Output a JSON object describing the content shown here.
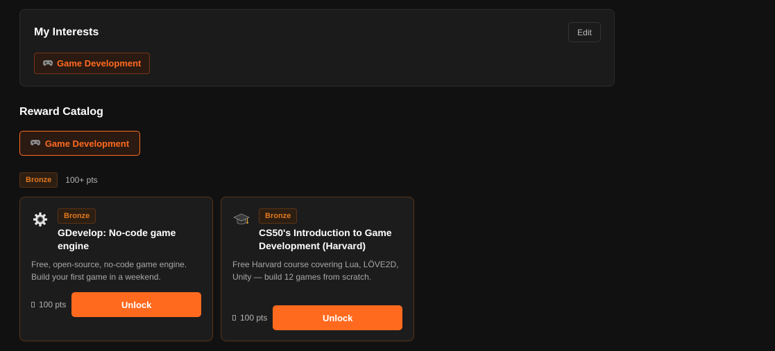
{
  "interests": {
    "title": "My Interests",
    "edit_label": "Edit",
    "items": [
      {
        "icon": "gamepad-icon",
        "label": "Game Development"
      }
    ]
  },
  "catalog": {
    "title": "Reward Catalog",
    "filter": {
      "icon": "gamepad-icon",
      "label": "Game Development"
    },
    "tier": {
      "label": "Bronze",
      "points": "100+ pts"
    },
    "rewards": [
      {
        "icon": "gear-icon",
        "badge": "Bronze",
        "title": "GDevelop: No-code game engine",
        "description": "Free, open-source, no-code game engine. Build your first game in a weekend.",
        "points": "100 pts",
        "unlock_label": "Unlock"
      },
      {
        "icon": "graduation-cap-icon",
        "badge": "Bronze",
        "title": "CS50's Introduction to Game Development (Harvard)",
        "description": "Free Harvard course covering Lua, LÖVE2D, Unity — build 12 games from scratch.",
        "points": "100 pts",
        "unlock_label": "Unlock"
      }
    ]
  },
  "colors": {
    "background": "#111111",
    "accent": "#ff6a1f",
    "bronze": "#e0781f",
    "card": "#1c1c1c"
  }
}
